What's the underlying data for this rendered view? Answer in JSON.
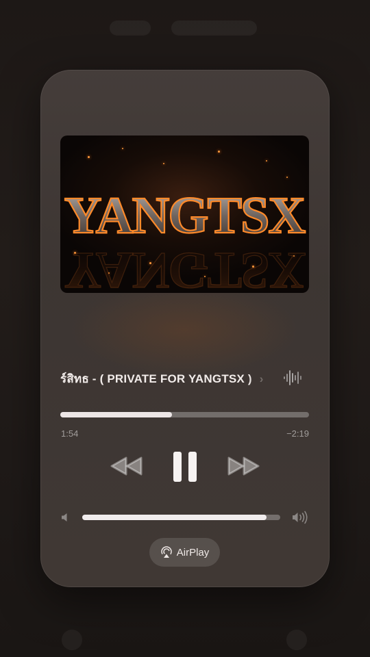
{
  "now_playing": {
    "title": "ร์สิทธ - ( PRIVATE FOR YANGTSX )",
    "title_overflow_glyph": "›",
    "artwork_text": "YANGTSX",
    "elapsed": "1:54",
    "remaining": "−2:19",
    "progress_fraction": 0.45
  },
  "controls": {
    "rewind_icon": "rewind-icon",
    "pause_icon": "pause-icon",
    "forward_icon": "fast-forward-icon"
  },
  "volume": {
    "level_fraction": 0.93,
    "low_icon": "speaker-low-icon",
    "high_icon": "speaker-high-icon"
  },
  "airplay": {
    "label": "AirPlay",
    "icon": "airplay-icon"
  },
  "colors": {
    "card_bg": "#453d3a",
    "accent_fill": "#ede6e6",
    "artwork_glow": "#ff8a2a"
  }
}
